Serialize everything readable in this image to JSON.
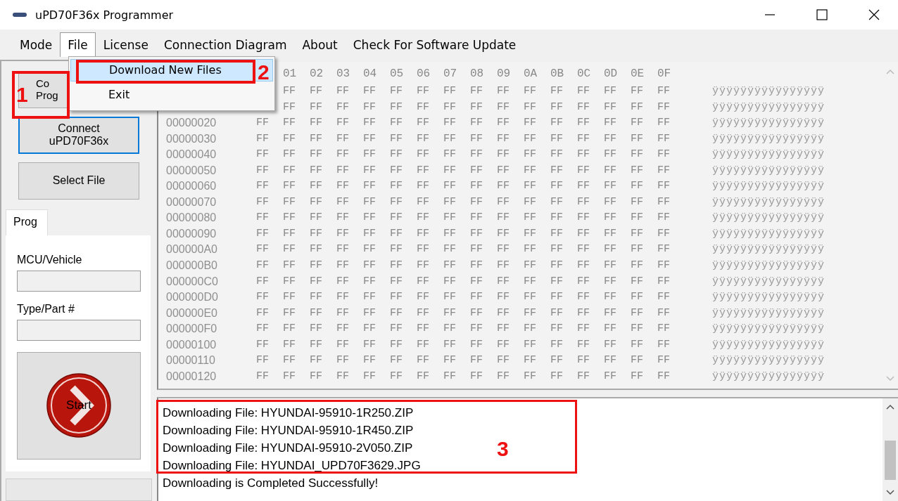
{
  "window": {
    "title": "uPD70F36x Programmer"
  },
  "menu": [
    {
      "label": "Mode",
      "selected": false
    },
    {
      "label": "File",
      "selected": true
    },
    {
      "label": "License",
      "selected": false
    },
    {
      "label": "Connection Diagram",
      "selected": false
    },
    {
      "label": "About",
      "selected": false
    },
    {
      "label": "Check For Software Update",
      "selected": false
    }
  ],
  "dropdown": [
    {
      "label": "Download New Files",
      "selected": true
    },
    {
      "label": "Exit",
      "selected": false
    }
  ],
  "side_buttons": [
    {
      "lines": [
        "Co",
        "Prog"
      ],
      "focused": false
    },
    {
      "lines": [
        "Connect",
        "uPD70F36x"
      ],
      "focused": true
    },
    {
      "lines": [
        "Select File"
      ],
      "focused": false
    }
  ],
  "tab": {
    "label": "Prog"
  },
  "fields": [
    {
      "label": "MCU/Vehicle"
    },
    {
      "label": "Type/Part #"
    }
  ],
  "start_button": {
    "label": "Start"
  },
  "hex": {
    "header": [
      "01",
      "02",
      "03",
      "04",
      "05",
      "06",
      "07",
      "08",
      "09",
      "0A",
      "0B",
      "0C",
      "0D",
      "0E",
      "0F"
    ],
    "rows": [
      {
        "bytes": [
          "FF",
          "FF",
          "FF",
          "FF",
          "FF",
          "FF",
          "FF",
          "FF",
          "FF",
          "FF",
          "FF",
          "FF",
          "FF",
          "FF",
          "FF"
        ],
        "ascii": "ÿÿÿÿÿÿÿÿÿÿÿÿÿÿÿÿ"
      },
      {
        "bytes": [
          "FF",
          "FF",
          "FF",
          "FF",
          "FF",
          "FF",
          "FF",
          "FF",
          "FF",
          "FF",
          "FF",
          "FF",
          "FF",
          "FF",
          "FF"
        ],
        "ascii": "ÿÿÿÿÿÿÿÿÿÿÿÿÿÿÿÿ"
      },
      {
        "address": "00000020",
        "bytes": [
          "FF",
          "FF",
          "FF",
          "FF",
          "FF",
          "FF",
          "FF",
          "FF",
          "FF",
          "FF",
          "FF",
          "FF",
          "FF",
          "FF",
          "FF",
          "FF"
        ],
        "ascii": "ÿÿÿÿÿÿÿÿÿÿÿÿÿÿÿÿ"
      },
      {
        "address": "00000030",
        "bytes": [
          "FF",
          "FF",
          "FF",
          "FF",
          "FF",
          "FF",
          "FF",
          "FF",
          "FF",
          "FF",
          "FF",
          "FF",
          "FF",
          "FF",
          "FF",
          "FF"
        ],
        "ascii": "ÿÿÿÿÿÿÿÿÿÿÿÿÿÿÿÿ"
      },
      {
        "address": "00000040",
        "bytes": [
          "FF",
          "FF",
          "FF",
          "FF",
          "FF",
          "FF",
          "FF",
          "FF",
          "FF",
          "FF",
          "FF",
          "FF",
          "FF",
          "FF",
          "FF",
          "FF"
        ],
        "ascii": "ÿÿÿÿÿÿÿÿÿÿÿÿÿÿÿÿ"
      },
      {
        "address": "00000050",
        "bytes": [
          "FF",
          "FF",
          "FF",
          "FF",
          "FF",
          "FF",
          "FF",
          "FF",
          "FF",
          "FF",
          "FF",
          "FF",
          "FF",
          "FF",
          "FF",
          "FF"
        ],
        "ascii": "ÿÿÿÿÿÿÿÿÿÿÿÿÿÿÿÿ"
      },
      {
        "address": "00000060",
        "bytes": [
          "FF",
          "FF",
          "FF",
          "FF",
          "FF",
          "FF",
          "FF",
          "FF",
          "FF",
          "FF",
          "FF",
          "FF",
          "FF",
          "FF",
          "FF",
          "FF"
        ],
        "ascii": "ÿÿÿÿÿÿÿÿÿÿÿÿÿÿÿÿ"
      },
      {
        "address": "00000070",
        "bytes": [
          "FF",
          "FF",
          "FF",
          "FF",
          "FF",
          "FF",
          "FF",
          "FF",
          "FF",
          "FF",
          "FF",
          "FF",
          "FF",
          "FF",
          "FF",
          "FF"
        ],
        "ascii": "ÿÿÿÿÿÿÿÿÿÿÿÿÿÿÿÿ"
      },
      {
        "address": "00000080",
        "bytes": [
          "FF",
          "FF",
          "FF",
          "FF",
          "FF",
          "FF",
          "FF",
          "FF",
          "FF",
          "FF",
          "FF",
          "FF",
          "FF",
          "FF",
          "FF",
          "FF"
        ],
        "ascii": "ÿÿÿÿÿÿÿÿÿÿÿÿÿÿÿÿ"
      },
      {
        "address": "00000090",
        "bytes": [
          "FF",
          "FF",
          "FF",
          "FF",
          "FF",
          "FF",
          "FF",
          "FF",
          "FF",
          "FF",
          "FF",
          "FF",
          "FF",
          "FF",
          "FF",
          "FF"
        ],
        "ascii": "ÿÿÿÿÿÿÿÿÿÿÿÿÿÿÿÿ"
      },
      {
        "address": "000000A0",
        "bytes": [
          "FF",
          "FF",
          "FF",
          "FF",
          "FF",
          "FF",
          "FF",
          "FF",
          "FF",
          "FF",
          "FF",
          "FF",
          "FF",
          "FF",
          "FF",
          "FF"
        ],
        "ascii": "ÿÿÿÿÿÿÿÿÿÿÿÿÿÿÿÿ"
      },
      {
        "address": "000000B0",
        "bytes": [
          "FF",
          "FF",
          "FF",
          "FF",
          "FF",
          "FF",
          "FF",
          "FF",
          "FF",
          "FF",
          "FF",
          "FF",
          "FF",
          "FF",
          "FF",
          "FF"
        ],
        "ascii": "ÿÿÿÿÿÿÿÿÿÿÿÿÿÿÿÿ"
      },
      {
        "address": "000000C0",
        "bytes": [
          "FF",
          "FF",
          "FF",
          "FF",
          "FF",
          "FF",
          "FF",
          "FF",
          "FF",
          "FF",
          "FF",
          "FF",
          "FF",
          "FF",
          "FF",
          "FF"
        ],
        "ascii": "ÿÿÿÿÿÿÿÿÿÿÿÿÿÿÿÿ"
      },
      {
        "address": "000000D0",
        "bytes": [
          "FF",
          "FF",
          "FF",
          "FF",
          "FF",
          "FF",
          "FF",
          "FF",
          "FF",
          "FF",
          "FF",
          "FF",
          "FF",
          "FF",
          "FF",
          "FF"
        ],
        "ascii": "ÿÿÿÿÿÿÿÿÿÿÿÿÿÿÿÿ"
      },
      {
        "address": "000000E0",
        "bytes": [
          "FF",
          "FF",
          "FF",
          "FF",
          "FF",
          "FF",
          "FF",
          "FF",
          "FF",
          "FF",
          "FF",
          "FF",
          "FF",
          "FF",
          "FF",
          "FF"
        ],
        "ascii": "ÿÿÿÿÿÿÿÿÿÿÿÿÿÿÿÿ"
      },
      {
        "address": "000000F0",
        "bytes": [
          "FF",
          "FF",
          "FF",
          "FF",
          "FF",
          "FF",
          "FF",
          "FF",
          "FF",
          "FF",
          "FF",
          "FF",
          "FF",
          "FF",
          "FF",
          "FF"
        ],
        "ascii": "ÿÿÿÿÿÿÿÿÿÿÿÿÿÿÿÿ"
      },
      {
        "address": "00000100",
        "bytes": [
          "FF",
          "FF",
          "FF",
          "FF",
          "FF",
          "FF",
          "FF",
          "FF",
          "FF",
          "FF",
          "FF",
          "FF",
          "FF",
          "FF",
          "FF",
          "FF"
        ],
        "ascii": "ÿÿÿÿÿÿÿÿÿÿÿÿÿÿÿÿ"
      },
      {
        "address": "00000110",
        "bytes": [
          "FF",
          "FF",
          "FF",
          "FF",
          "FF",
          "FF",
          "FF",
          "FF",
          "FF",
          "FF",
          "FF",
          "FF",
          "FF",
          "FF",
          "FF",
          "FF"
        ],
        "ascii": "ÿÿÿÿÿÿÿÿÿÿÿÿÿÿÿÿ"
      },
      {
        "address": "00000120",
        "bytes": [
          "FF",
          "FF",
          "FF",
          "FF",
          "FF",
          "FF",
          "FF",
          "FF",
          "FF",
          "FF",
          "FF",
          "FF",
          "FF",
          "FF",
          "FF",
          "FF"
        ],
        "ascii": "ÿÿÿÿÿÿÿÿÿÿÿÿÿÿÿÿ"
      }
    ]
  },
  "log": [
    "Downloading File: HYUNDAI-95910-1R250.ZIP",
    "Downloading File: HYUNDAI-95910-1R450.ZIP",
    "Downloading File: HYUNDAI-95910-2V050.ZIP",
    "Downloading File: HYUNDAI_UPD70F3629.JPG",
    "Downloading is Completed Successfully!"
  ],
  "annotations": [
    {
      "number": "1"
    },
    {
      "number": "2"
    },
    {
      "number": "3"
    }
  ]
}
